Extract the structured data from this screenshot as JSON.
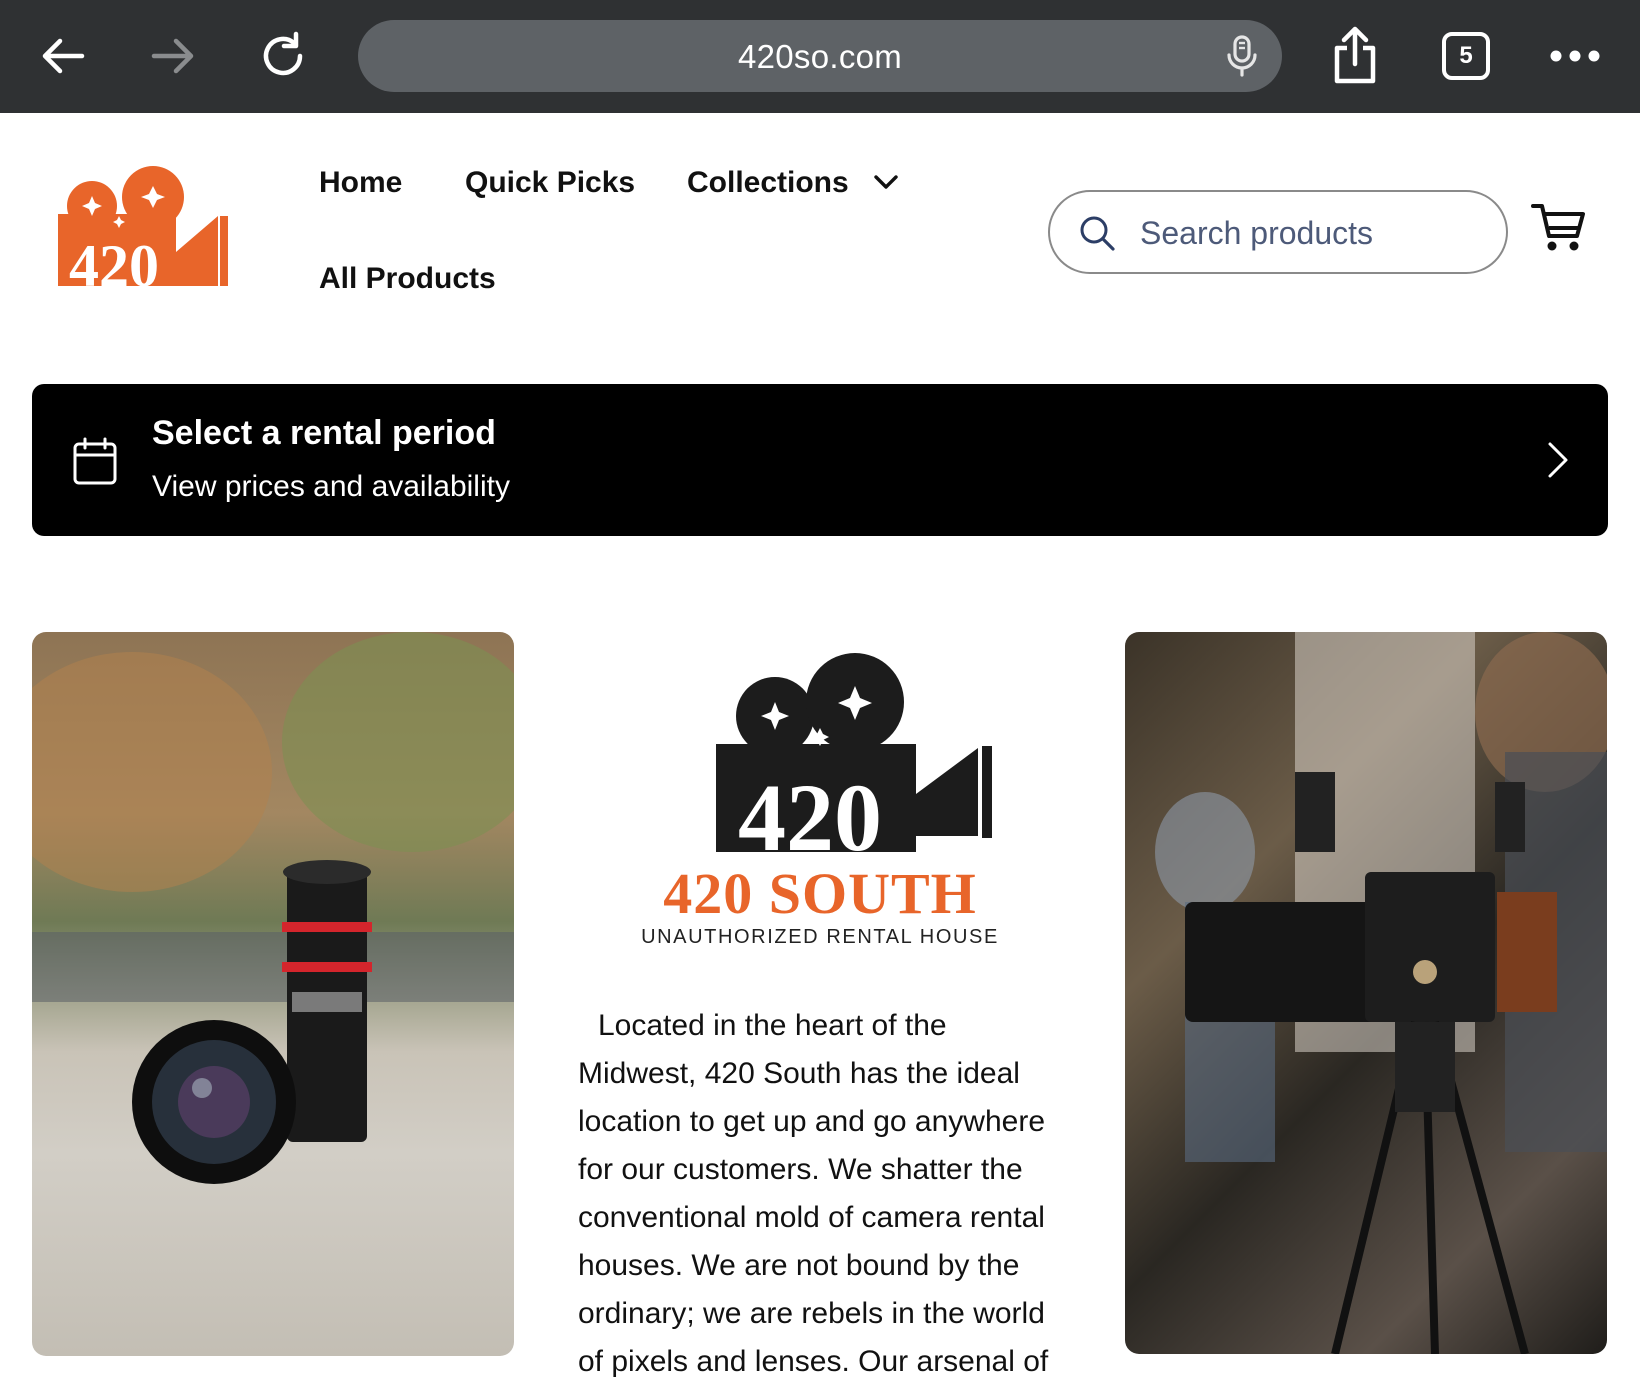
{
  "browser": {
    "url": "420so.com",
    "tab_count": "5"
  },
  "header": {
    "nav": [
      "Home",
      "Quick Picks",
      "Collections",
      "All Products"
    ],
    "search_placeholder": "Search products"
  },
  "rental": {
    "title": "Select a rental period",
    "subtitle": "View prices and availability"
  },
  "brand": {
    "logo_text": "420",
    "name": "420 SOUTH",
    "tagline": "UNAUTHORIZED RENTAL HOUSE",
    "accent_color": "#e8652a"
  },
  "about": {
    "text": "Located in the heart of the Midwest, 420 South has the ideal location to get up and go anywhere for our customers. We shatter the conventional mold of camera rental houses. We are not bound by the ordinary; we are rebels in the world of pixels and lenses. Our arsenal of"
  }
}
